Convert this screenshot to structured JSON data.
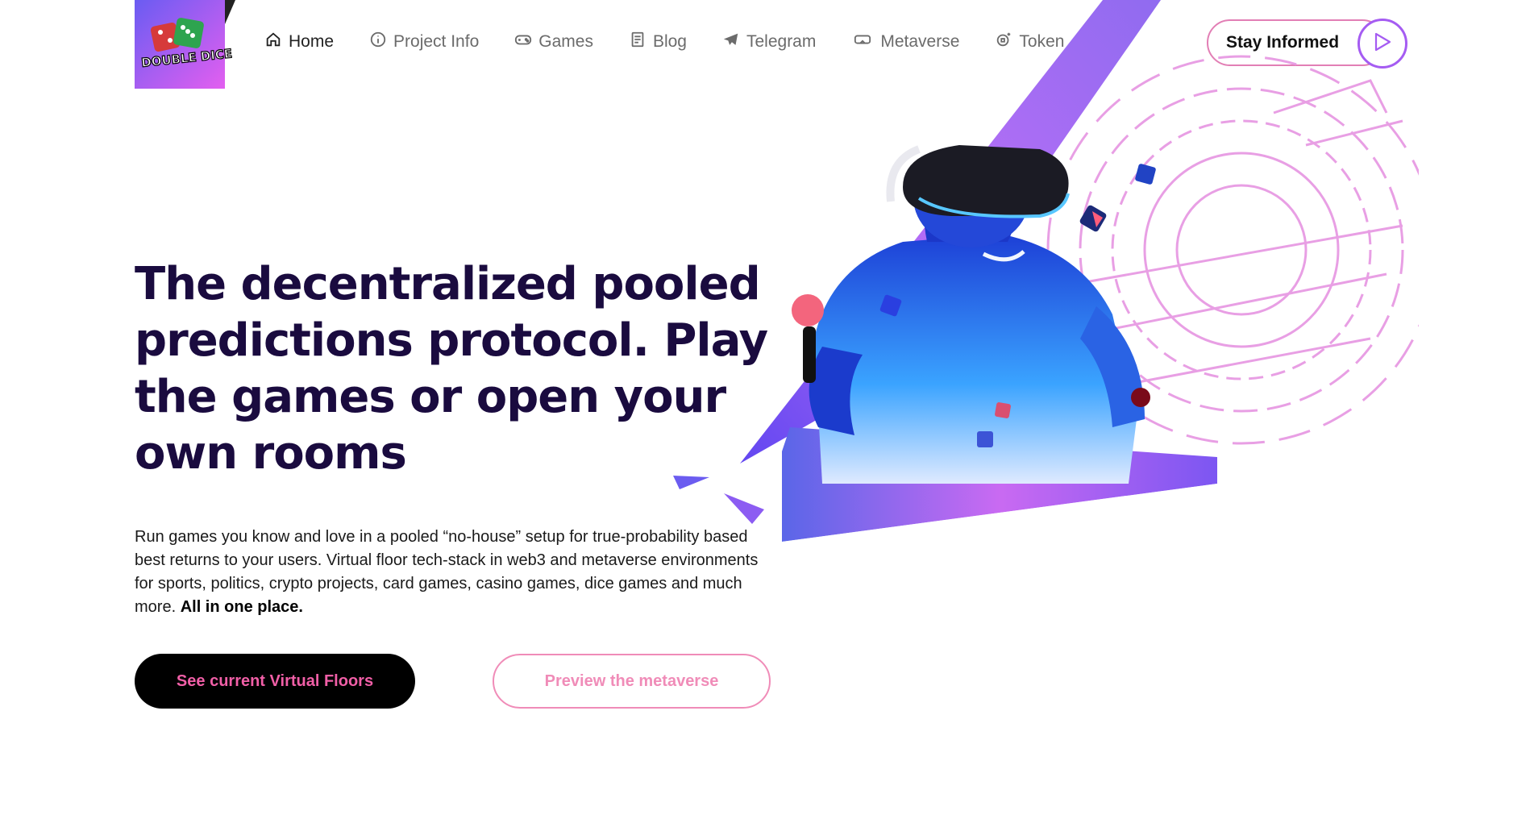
{
  "brand": {
    "logo_text": "DOUBLE DICE"
  },
  "nav": {
    "items": [
      {
        "label": "Home",
        "icon": "home-icon"
      },
      {
        "label": "Project Info",
        "icon": "info-icon"
      },
      {
        "label": "Games",
        "icon": "gamepad-icon"
      },
      {
        "label": "Blog",
        "icon": "document-icon"
      },
      {
        "label": "Telegram",
        "icon": "telegram-icon"
      },
      {
        "label": "Metaverse",
        "icon": "vr-headset-icon"
      },
      {
        "label": "Token",
        "icon": "token-icon"
      }
    ]
  },
  "header_cta": {
    "label": "Stay Informed",
    "icon": "play-icon"
  },
  "hero": {
    "headline": "The decentralized pooled predictions protocol. Play the games or open your own rooms",
    "description": "Run games you know and love in a pooled “no-house” setup for true-probability based best returns to your users. Virtual floor tech-stack in web3 and metaverse environments for sports, politics, crypto projects, card games, casino games, dice games and much more.",
    "description_strong": "All in one place.",
    "primary_button": "See current Virtual Floors",
    "secondary_button": "Preview the metaverse"
  },
  "colors": {
    "accent_pink": "#f15fa7",
    "accent_purple": "#a55cf2",
    "headline": "#1a0b3f"
  }
}
